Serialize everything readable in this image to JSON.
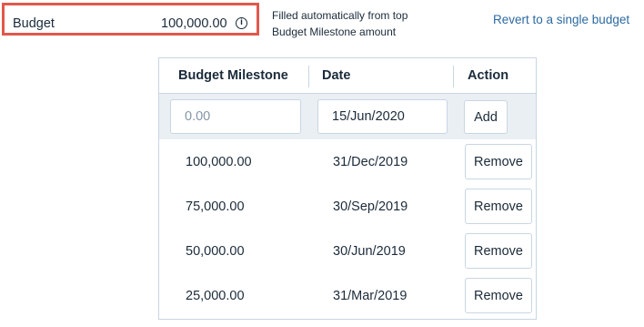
{
  "budget": {
    "label": "Budget",
    "value": "100,000.00",
    "info_icon": "info-icon"
  },
  "note": {
    "line1": "Filled automatically from top",
    "line2": "Budget Milestone amount"
  },
  "revert_link": "Revert to a single budget",
  "table": {
    "headers": [
      "Budget Milestone",
      "Date",
      "Action"
    ],
    "new_entry": {
      "amount_placeholder": "0.00",
      "date_value": "15/Jun/2020",
      "add_label": "Add"
    },
    "rows": [
      {
        "amount": "100,000.00",
        "date": "31/Dec/2019",
        "action": "Remove"
      },
      {
        "amount": "75,000.00",
        "date": "30/Sep/2019",
        "action": "Remove"
      },
      {
        "amount": "50,000.00",
        "date": "30/Jun/2019",
        "action": "Remove"
      },
      {
        "amount": "25,000.00",
        "date": "31/Mar/2019",
        "action": "Remove"
      }
    ]
  },
  "colors": {
    "highlight_border": "#e2574c",
    "link": "#2c6aa0",
    "text": "#1b2b3a",
    "table_border": "#c9d6e3",
    "add_row_bg": "#eaeff4"
  }
}
